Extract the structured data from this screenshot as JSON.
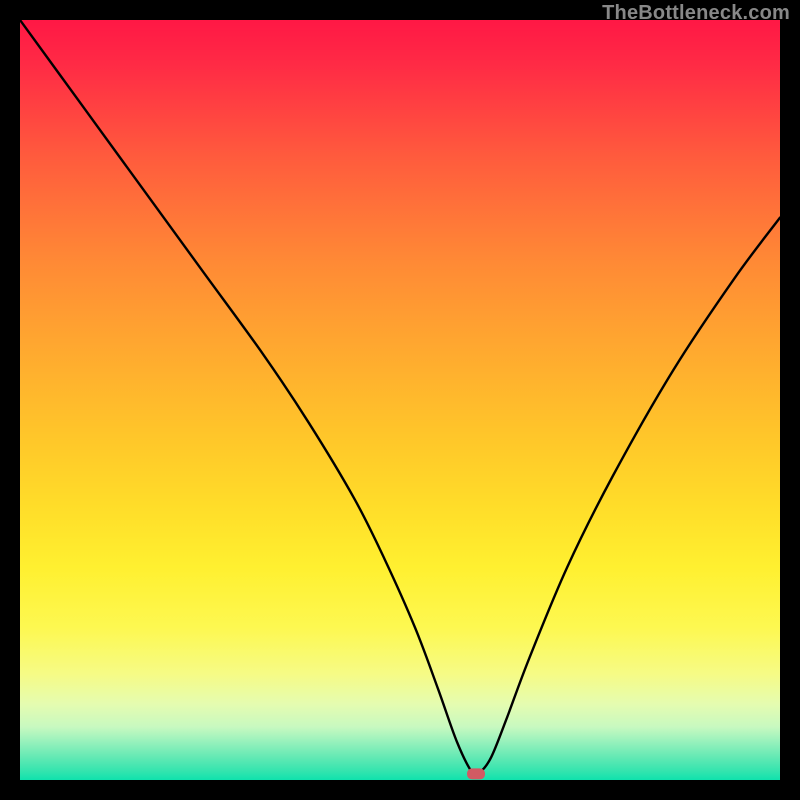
{
  "watermark": "TheBottleneck.com",
  "chart_data": {
    "type": "line",
    "title": "",
    "xlabel": "",
    "ylabel": "",
    "xlim": [
      0,
      100
    ],
    "ylim": [
      0,
      100
    ],
    "series": [
      {
        "name": "bottleneck-curve",
        "x": [
          0,
          8,
          16,
          24,
          32,
          38,
          44,
          48,
          52,
          55,
          57.5,
          59.5,
          60.5,
          62,
          64,
          67,
          72,
          78,
          86,
          94,
          100
        ],
        "y": [
          100,
          89,
          78,
          67,
          56,
          47,
          37,
          29,
          20,
          12,
          5,
          1,
          1,
          3,
          8,
          16,
          28,
          40,
          54,
          66,
          74
        ]
      }
    ],
    "marker": {
      "x": 60,
      "y": 0.8,
      "color": "#d25a63"
    },
    "background": "rainbow-gradient"
  }
}
